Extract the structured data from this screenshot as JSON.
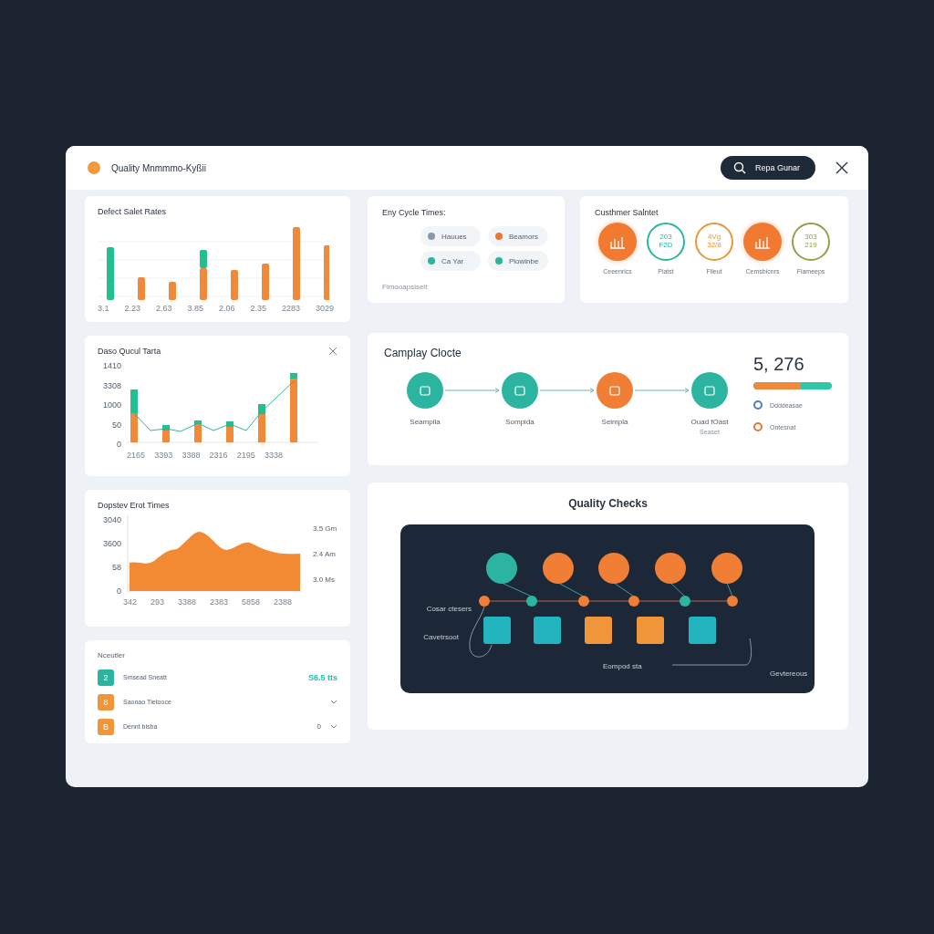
{
  "window": {
    "title": "Quality Mnmmmo-Kyßii"
  },
  "search_button": {
    "label": "Repa Gunar"
  },
  "defect_chart": {
    "title": "Defect Salet Rates",
    "x_labels": [
      "3.1",
      "2.23",
      "2.63",
      "3.85",
      "2.06",
      "2.35",
      "2283",
      "3029"
    ]
  },
  "cycle_times": {
    "title": "Eny Cycle Times:",
    "chips": [
      {
        "label": "Hauues",
        "color": "#8a98a8"
      },
      {
        "label": "Beamors",
        "color": "#e8763a"
      },
      {
        "label": "Ca Yar",
        "color": "#2bb5a0"
      },
      {
        "label": "Plowinbe",
        "color": "#2bb5a0"
      }
    ],
    "footer": "Fimooapsiselt"
  },
  "customer": {
    "title": "Custhmer Salntet",
    "items": [
      {
        "kind": "filled",
        "label": "Ceeenrics"
      },
      {
        "kind": "outline",
        "label": "Piatst",
        "value": "203 F2D",
        "color": "#2bb5a0"
      },
      {
        "kind": "outline",
        "label": "Fileut",
        "value": "4Vg 32/8",
        "color": "#e8963a"
      },
      {
        "kind": "filled",
        "label": "Cemsbicnrs"
      },
      {
        "kind": "outline",
        "label": "Flameeps",
        "value": "303 219",
        "color": "#8fa04a"
      }
    ]
  },
  "quality_chart": {
    "title": "Daso Qucul Tarta",
    "y_labels": [
      "1410",
      "3308",
      "1000",
      "50",
      "0"
    ],
    "x_labels": [
      "2165",
      "3393",
      "3388",
      "2316",
      "2195",
      "3338"
    ]
  },
  "process": {
    "title": "Camplay Clocte",
    "steps": [
      {
        "label": "Seampila",
        "color": "#2bb5a0"
      },
      {
        "label": "Sompida",
        "color": "#2bb5a0"
      },
      {
        "label": "Seimpla",
        "color": "#f07f35"
      },
      {
        "label": "Ouad fOast",
        "sub": "Seaset",
        "color": "#2bb5a0"
      }
    ],
    "count": "5, 276",
    "level": 0.6,
    "legend": [
      {
        "label": "Ddddeasae",
        "color": "#4a7bd0"
      },
      {
        "label": "Ontesnat",
        "color": "#e8763a"
      }
    ]
  },
  "downtime_chart": {
    "title": "Dopstev Erot Times",
    "y_labels": [
      "3040",
      "3600",
      "58",
      "0"
    ],
    "right_labels": [
      "3.5 Gm",
      "2.4 Am",
      "3.0 Ms"
    ],
    "x_labels": [
      "342",
      "293",
      "3388",
      "2383",
      "5858",
      "2388"
    ]
  },
  "results": {
    "title": "Nceutler",
    "rows": [
      {
        "kind": "value",
        "icon": "2",
        "label": "Smsead Sneatt",
        "value": "S6.5 tts",
        "color": "#2bb5a0"
      },
      {
        "kind": "chevron",
        "icon": "8",
        "label": "Saonao Tletooce",
        "color": "#f0953a"
      },
      {
        "kind": "chevron",
        "icon": "B",
        "label": "Dennt bisba",
        "value": "0",
        "color": "#f0953a"
      }
    ]
  },
  "quality_checks": {
    "title": "Quality Checks",
    "circles": [
      {
        "color": "#2bb5a0"
      },
      {
        "color": "#f07f35"
      },
      {
        "color": "#f07f35"
      },
      {
        "color": "#f07f35"
      },
      {
        "color": "#f07f35"
      }
    ],
    "dots": [
      {
        "color": "#f07f35"
      },
      {
        "color": "#2bb5a0"
      },
      {
        "color": "#f07f35"
      },
      {
        "color": "#f07f35"
      },
      {
        "color": "#2bb5a0"
      },
      {
        "color": "#f07f35"
      }
    ],
    "boxes": [
      {
        "color": "#22b5c0"
      },
      {
        "color": "#22b5c0"
      },
      {
        "color": "#f0953a"
      },
      {
        "color": "#f0953a"
      },
      {
        "color": "#22b5c0"
      }
    ],
    "labels": [
      "Cosar ctesers",
      "Cavetrsoot",
      "Eompod sta",
      "Gevtereous"
    ]
  }
}
